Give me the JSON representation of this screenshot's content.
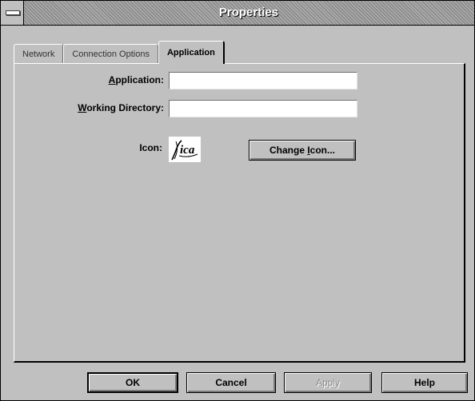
{
  "window": {
    "title": "Properties"
  },
  "tabs": [
    {
      "label": "Network"
    },
    {
      "label": "Connection Options"
    },
    {
      "label": "Application"
    }
  ],
  "form": {
    "application": {
      "label_prefix": "",
      "label_mnemonic": "A",
      "label_rest": "pplication:",
      "value": ""
    },
    "working_directory": {
      "label_mnemonic": "W",
      "label_rest": "orking Directory:",
      "value": ""
    },
    "icon": {
      "label": "Icon:",
      "icon_name": "ica-icon",
      "icon_text": "ica"
    },
    "change_icon_button": {
      "label_pre": "Change ",
      "label_mnemonic": "I",
      "label_post": "con..."
    }
  },
  "buttons": {
    "ok": "OK",
    "cancel": "Cancel",
    "apply": "Apply",
    "help": "Help"
  }
}
